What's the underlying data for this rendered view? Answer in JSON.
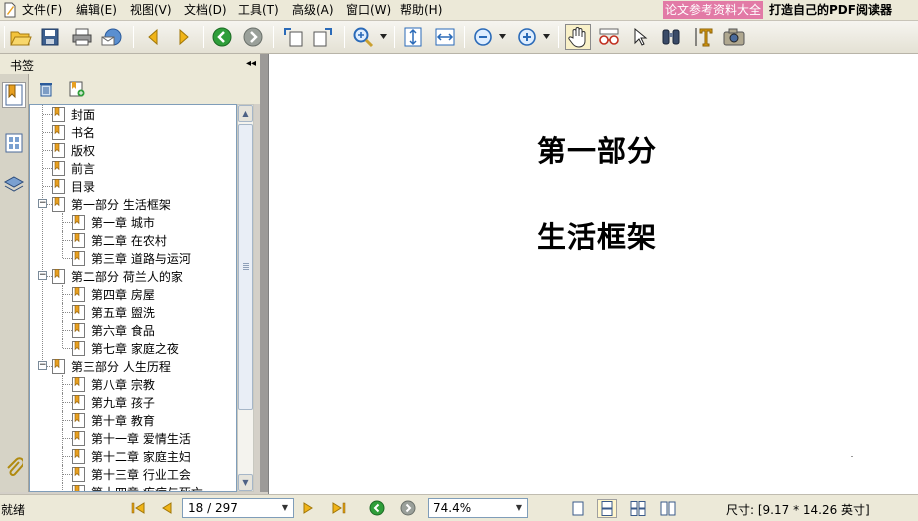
{
  "menu": {
    "items": [
      {
        "label": "文件(F)"
      },
      {
        "label": "编辑(E)"
      },
      {
        "label": "视图(V)"
      },
      {
        "label": "文档(D)"
      },
      {
        "label": "工具(T)"
      },
      {
        "label": "高级(A)"
      },
      {
        "label": "窗口(W)"
      },
      {
        "label": "帮助(H)"
      }
    ],
    "promo_pink": "论文参考资料大全",
    "promo_right": "打造自己的PDF阅读器"
  },
  "toolbar": {
    "icons": [
      "open-icon",
      "save-icon",
      "print-icon",
      "email-icon",
      "back-icon",
      "forward-icon",
      "go-back-icon",
      "go-forward-icon",
      "rotate-ccw-icon",
      "rotate-cw-icon",
      "zoom-icon",
      "fit-page-icon",
      "fit-width-icon",
      "zoom-out-icon",
      "zoom-in-icon",
      "hand-tool-icon",
      "reading-glasses-icon",
      "select-arrow-icon",
      "find-binoculars-icon",
      "text-select-icon",
      "snapshot-icon"
    ]
  },
  "bookmarks_panel": {
    "title": "书签",
    "collapse_glyph": "◂◂"
  },
  "bookmarks": [
    {
      "label": "封面",
      "level": 0,
      "expanded": null
    },
    {
      "label": "书名",
      "level": 0,
      "expanded": null
    },
    {
      "label": "版权",
      "level": 0,
      "expanded": null
    },
    {
      "label": "前言",
      "level": 0,
      "expanded": null
    },
    {
      "label": "目录",
      "level": 0,
      "expanded": null
    },
    {
      "label": "第一部分  生活框架",
      "level": 0,
      "expanded": true
    },
    {
      "label": "第一章   城市",
      "level": 1,
      "expanded": null
    },
    {
      "label": "第二章   在农村",
      "level": 1,
      "expanded": null
    },
    {
      "label": "第三章   道路与运河",
      "level": 1,
      "expanded": null
    },
    {
      "label": "第二部分   荷兰人的家",
      "level": 0,
      "expanded": true
    },
    {
      "label": "第四章  房屋",
      "level": 1,
      "expanded": null
    },
    {
      "label": "第五章   盥洗",
      "level": 1,
      "expanded": null
    },
    {
      "label": "第六章   食品",
      "level": 1,
      "expanded": null
    },
    {
      "label": "第七章   家庭之夜",
      "level": 1,
      "expanded": null
    },
    {
      "label": "第三部分   人生历程",
      "level": 0,
      "expanded": true
    },
    {
      "label": "第八章  宗教",
      "level": 1,
      "expanded": null
    },
    {
      "label": "第九章  孩子",
      "level": 1,
      "expanded": null
    },
    {
      "label": "第十章  教育",
      "level": 1,
      "expanded": null
    },
    {
      "label": "第十一章  爱情生活",
      "level": 1,
      "expanded": null
    },
    {
      "label": "第十二章  家庭主妇",
      "level": 1,
      "expanded": null
    },
    {
      "label": "第十三章  行业工会",
      "level": 1,
      "expanded": null
    },
    {
      "label": "第十四章  疾病与死亡",
      "level": 1,
      "expanded": null
    }
  ],
  "document": {
    "line1": "第一部分",
    "line2": "生活框架"
  },
  "status": {
    "text": "就绪",
    "page": "18 / 297",
    "zoom": "74.4%",
    "size": "尺寸: [9.17 * 14.26 英寸]"
  }
}
